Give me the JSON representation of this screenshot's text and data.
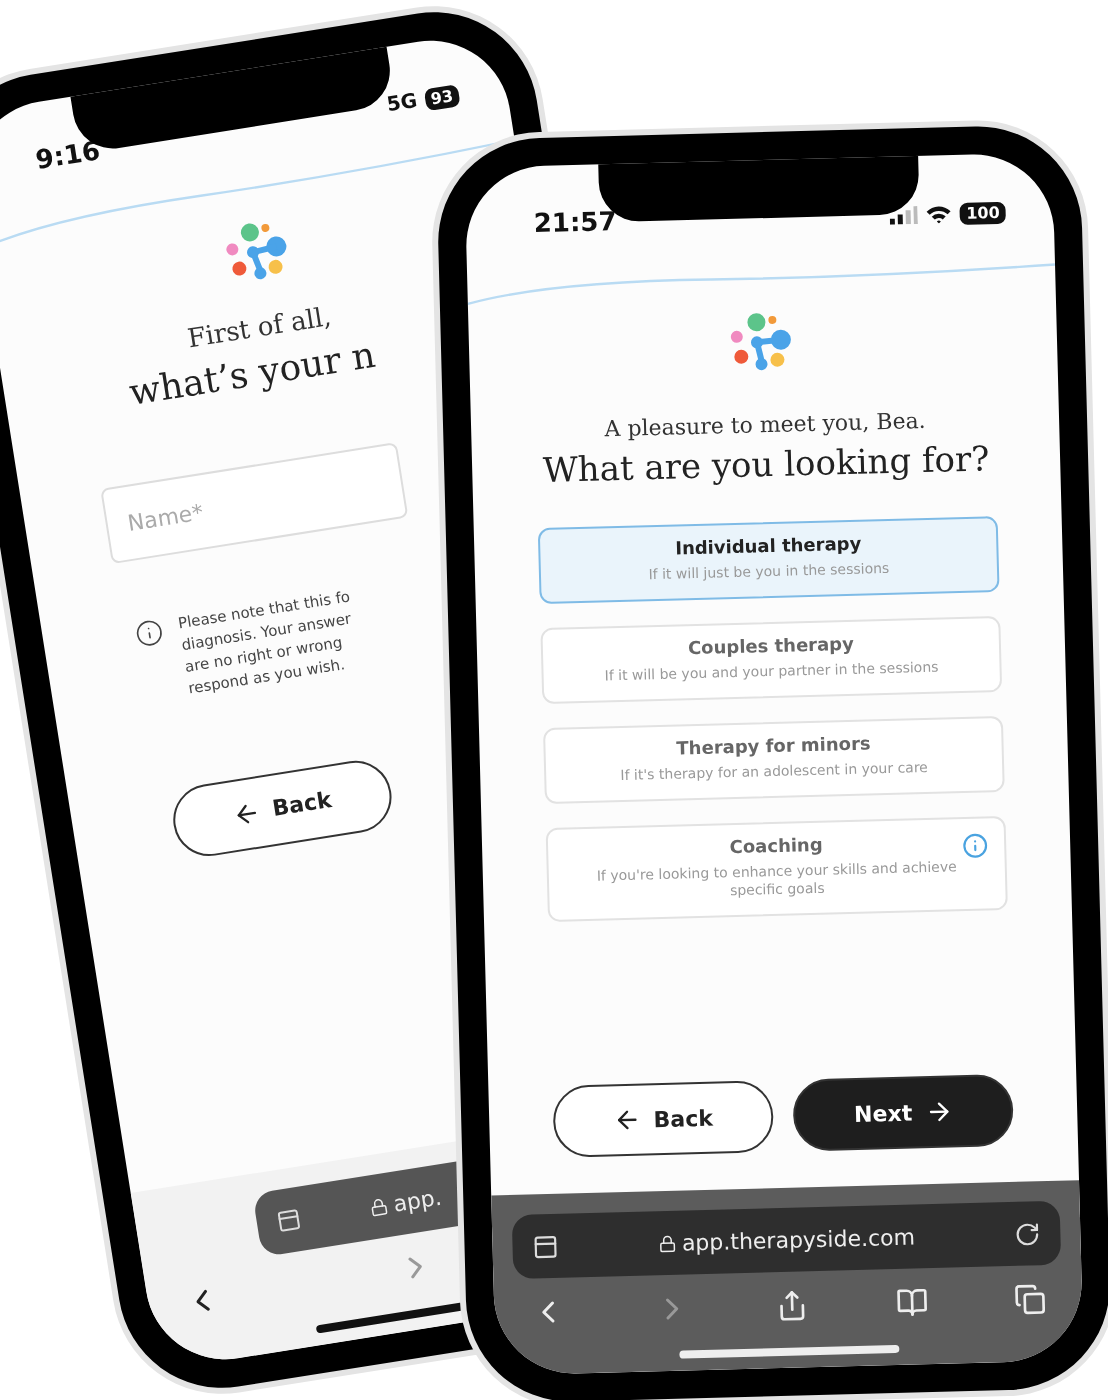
{
  "back_phone": {
    "status_bar": {
      "time": "9:16",
      "network": "5G",
      "battery": "93"
    },
    "intro": "First of all,",
    "heading": "what’s your n",
    "name_field": {
      "placeholder": "Name*"
    },
    "note_lines": [
      "Please note that this fo",
      "diagnosis. Your answer",
      "are no right or wrong",
      "respond as you wish."
    ],
    "back_button": "Back",
    "url": "app."
  },
  "front_phone": {
    "status_bar": {
      "time": "21:57",
      "battery": "100"
    },
    "greeting": "A pleasure to meet you, Bea.",
    "heading": "What are you looking for?",
    "options": [
      {
        "title": "Individual therapy",
        "subtitle": "If it will just be you in the sessions",
        "selected": true,
        "info": false
      },
      {
        "title": "Couples therapy",
        "subtitle": "If it will be you and your partner in the sessions",
        "selected": false,
        "info": false
      },
      {
        "title": "Therapy for minors",
        "subtitle": "If it's therapy for an adolescent in your care",
        "selected": false,
        "info": false
      },
      {
        "title": "Coaching",
        "subtitle": "If you're looking to enhance your skills and achieve specific goals",
        "selected": false,
        "info": true
      }
    ],
    "back_button": "Back",
    "next_button": "Next",
    "url": "app.therapyside.com"
  }
}
